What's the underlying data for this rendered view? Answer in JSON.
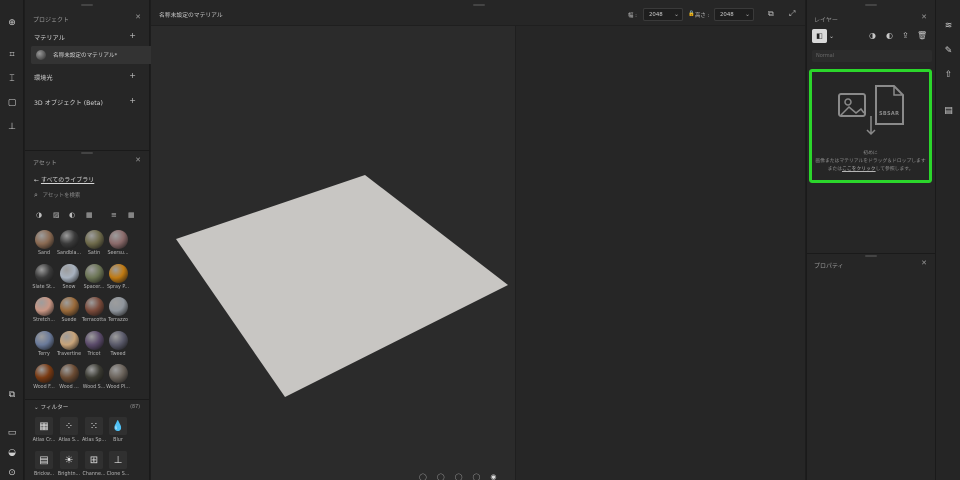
{
  "project_panel": {
    "title": "プロジェクト",
    "sections": [
      {
        "label": "マテリアル"
      },
      {
        "label": "環境光"
      },
      {
        "label": "3D オブジェクト (Beta)"
      }
    ],
    "material_item": "名称未設定のマテリアル*"
  },
  "assets_panel": {
    "title": "アセット",
    "back_link": "すべてのライブラリ",
    "search_placeholder": "アセットを検索",
    "materials": [
      {
        "label": "Sand",
        "color": "#8a6a52"
      },
      {
        "label": "Sandbla...",
        "color": "#3a3a3a"
      },
      {
        "label": "Satin",
        "color": "#6e6a4a"
      },
      {
        "label": "Seersu...",
        "color": "#8a6a6a"
      },
      {
        "label": "Slate St...",
        "color": "#3a3a3a"
      },
      {
        "label": "Snow",
        "color": "#a8b2bf"
      },
      {
        "label": "Spacer...",
        "color": "#6b7454"
      },
      {
        "label": "Spray P...",
        "color": "#c07a12"
      },
      {
        "label": "Stretch...",
        "color": "#c89684"
      },
      {
        "label": "Suede",
        "color": "#9a6a3a"
      },
      {
        "label": "Terracotta",
        "color": "#7a4a3a"
      },
      {
        "label": "Terrazzo",
        "color": "#8f959c"
      },
      {
        "label": "Terry",
        "color": "#6a7a9a"
      },
      {
        "label": "Travertine",
        "color": "#c8a47a"
      },
      {
        "label": "Tricot",
        "color": "#5a4a6a"
      },
      {
        "label": "Tweed",
        "color": "#5a5a6a"
      },
      {
        "label": "Wood F...",
        "color": "#7a3a12"
      },
      {
        "label": "Wood ...",
        "color": "#6a4a32"
      },
      {
        "label": "Wood S...",
        "color": "#3a3a32"
      },
      {
        "label": "Wood Pl...",
        "color": "#6a625a"
      }
    ],
    "filters_label": "フィルター",
    "filters_count": "(87)",
    "filters": [
      {
        "label": "Atlas Cr...",
        "icon": "checker-icon"
      },
      {
        "label": "Atlas S...",
        "icon": "dots-icon"
      },
      {
        "label": "Atlas Sp...",
        "icon": "scatter-icon"
      },
      {
        "label": "Blur",
        "icon": "drop-icon"
      },
      {
        "label": "Brickw...",
        "icon": "brick-icon"
      },
      {
        "label": "Brightn...",
        "icon": "sun-icon"
      },
      {
        "label": "Channe...",
        "icon": "channel-icon"
      },
      {
        "label": "Clone S...",
        "icon": "stamp-icon"
      }
    ]
  },
  "viewport": {
    "title": "名称未設定のマテリアル",
    "width_label": "幅 :",
    "width_value": "2048",
    "height_label": "高さ :",
    "height_value": "2048"
  },
  "layers_panel": {
    "title": "レイヤー",
    "blend_placeholder": "Normal",
    "drop_line1": "初めに",
    "drop_line2": "画像またはマテリアルをドラッグ＆ドロップします",
    "drop_line3_pre": "または",
    "drop_line3_link": "ここをクリック",
    "drop_line3_post": "して参照します。",
    "sbsar_label": "SBSAR"
  },
  "properties_panel": {
    "title": "プロパティ"
  }
}
